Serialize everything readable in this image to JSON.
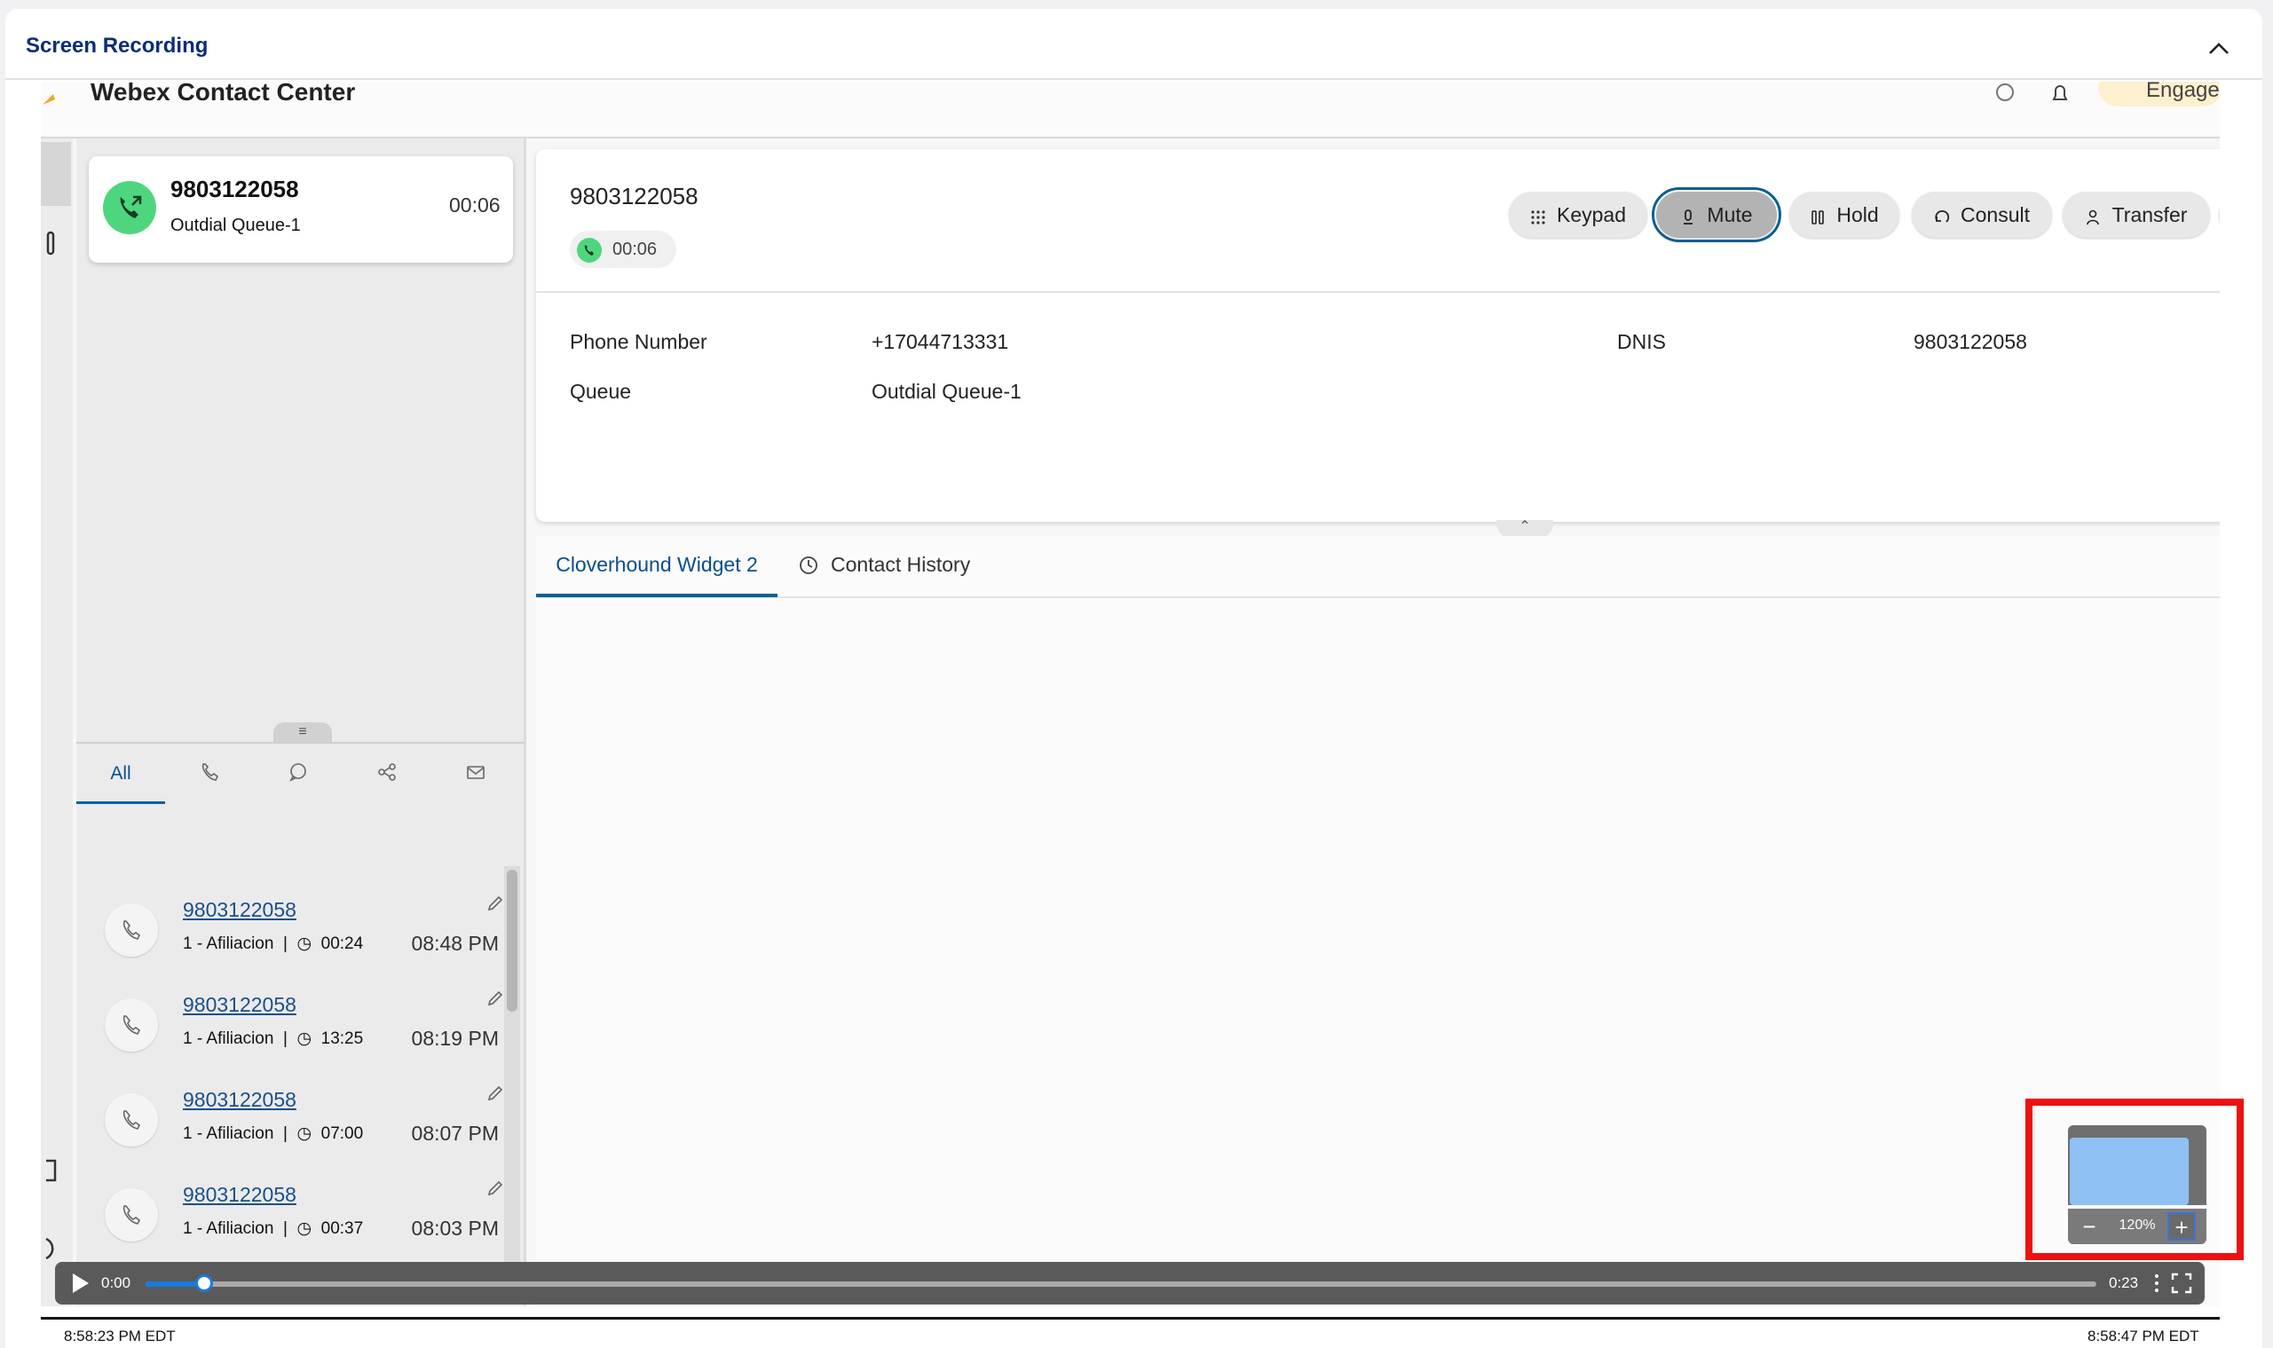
{
  "panel": {
    "title": "Screen Recording"
  },
  "recording": {
    "header": {
      "title": "Webex Contact Center",
      "badge": "Engaged"
    },
    "call_card": {
      "number": "9803122058",
      "queue": "Outdial Queue-1",
      "timer": "00:06"
    },
    "history": {
      "tabs": [
        {
          "label": "All",
          "icon": "all"
        },
        {
          "label": "",
          "icon": "phone-icon"
        },
        {
          "label": "",
          "icon": "chat-icon"
        },
        {
          "label": "",
          "icon": "share-icon"
        },
        {
          "label": "",
          "icon": "mail-icon"
        }
      ],
      "items": [
        {
          "number": "9803122058",
          "queue": "1 - Afiliacion",
          "duration": "00:24",
          "time": "08:48 PM"
        },
        {
          "number": "9803122058",
          "queue": "1 - Afiliacion",
          "duration": "13:25",
          "time": "08:19 PM"
        },
        {
          "number": "9803122058",
          "queue": "1 - Afiliacion",
          "duration": "07:00",
          "time": "08:07 PM"
        },
        {
          "number": "9803122058",
          "queue": "1 - Afiliacion",
          "duration": "00:37",
          "time": "08:03 PM"
        }
      ]
    },
    "main": {
      "number": "9803122058",
      "timer": "00:06",
      "controls": {
        "keypad": "Keypad",
        "mute": "Mute",
        "hold": "Hold",
        "consult": "Consult",
        "transfer": "Transfer"
      },
      "details": {
        "phone_label": "Phone Number",
        "phone_value": "+17044713331",
        "queue_label": "Queue",
        "queue_value": "Outdial Queue-1",
        "dnis_label": "DNIS",
        "dnis_value": "9803122058"
      },
      "tabs": {
        "widget": "Cloverhound Widget 2",
        "history": "Contact History"
      }
    }
  },
  "zoom": {
    "value": "120%",
    "minus": "−",
    "plus": "+"
  },
  "player": {
    "current": "0:00",
    "duration": "0:23",
    "progress_fraction": 0.03
  },
  "timestamps": {
    "start": "8:58:23 PM EDT",
    "end": "8:58:47 PM EDT"
  },
  "colors": {
    "accent": "#0a5f9a",
    "highlight": "#ee1111",
    "call_green": "#4ed67e"
  }
}
